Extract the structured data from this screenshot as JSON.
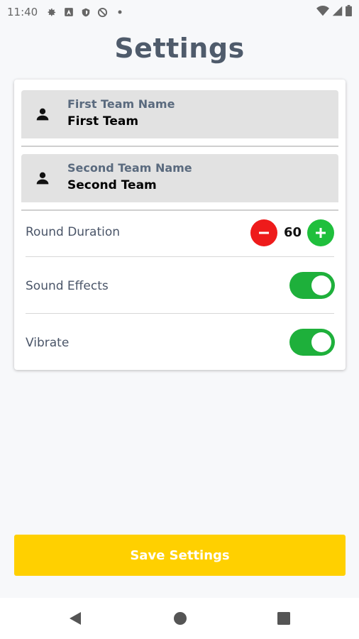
{
  "status_bar": {
    "time": "11:40",
    "left_icons": [
      "gear-icon",
      "a-box-icon",
      "shield-icon",
      "no-sync-icon",
      "dot-icon"
    ],
    "right_icons": [
      "wifi-icon",
      "signal-icon",
      "battery-icon"
    ]
  },
  "page": {
    "title": "Settings"
  },
  "settings": {
    "first_team": {
      "label": "First Team Name",
      "value": "First Team",
      "icon": "person-icon"
    },
    "second_team": {
      "label": "Second Team Name",
      "value": "Second Team",
      "icon": "person-icon"
    },
    "round_duration": {
      "label": "Round Duration",
      "value": "60",
      "decrement_color": "#ee1b1b",
      "increment_color": "#1fbf3c"
    },
    "sound_effects": {
      "label": "Sound Effects",
      "enabled": true
    },
    "vibrate": {
      "label": "Vibrate",
      "enabled": true
    }
  },
  "save_button": {
    "label": "Save Settings",
    "color": "#ffd000"
  },
  "nav_bar": {
    "buttons": [
      "back-icon",
      "home-icon",
      "recents-icon"
    ]
  }
}
